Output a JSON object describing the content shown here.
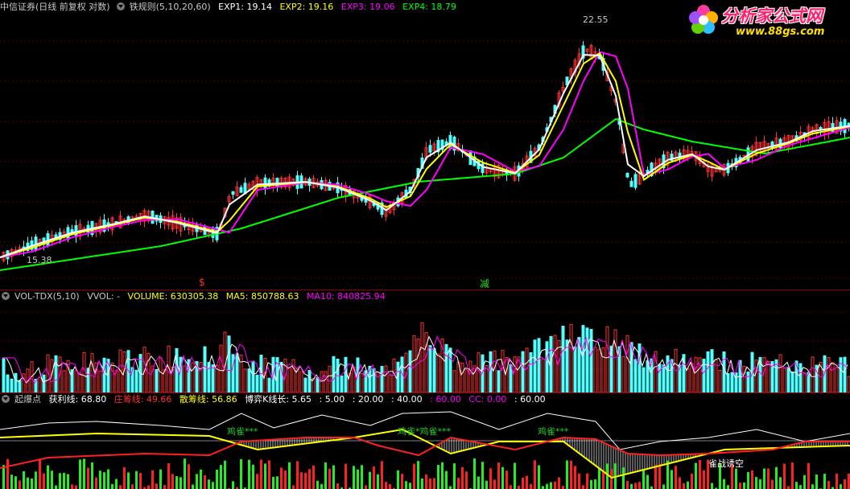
{
  "main": {
    "title": "中信证券(日线 前复权 对数)",
    "indicator": "铁规则(5,10,20,60)",
    "exp1": "EXP1: 19.14",
    "exp2": "EXP2: 19.16",
    "exp3": "EXP3: 19.06",
    "exp4": "EXP4: 18.79",
    "high_label": "22.55",
    "low_label": "15.38",
    "marker_s": "$",
    "marker_jian": "减"
  },
  "volume": {
    "indicator": "VOL-TDX(5,10)",
    "vvol": "VVOL: -",
    "volume": "VOLUME: 630305.38",
    "ma5": "MA5: 850788.63",
    "ma10": "MA10: 840825.94"
  },
  "bottom": {
    "indicator": "起爆点",
    "profit": "获利线: 68.80",
    "zhuang": "庄筹线: 49.66",
    "san": "散筹线: 56.86",
    "boyi": "博弈K线长: 5.65",
    "v1": ": 5.00",
    "v2": ": 20.00",
    "v3": ": 40.00",
    "v4": ": 60.00",
    "cc": "CC: 0.00",
    "v5": ": 60.00",
    "quezhan": "雀战诱空",
    "jique_labels": [
      "鸡雀***",
      "鸡雀*鸡雀***",
      "鸡雀***"
    ]
  },
  "logo": {
    "title": "分析家公式网",
    "url": "www.88gs.com"
  },
  "colors": {
    "ma5": "#ffffff",
    "ma10": "#ffff00",
    "ma20": "#ff00ff",
    "ma60": "#00ff00",
    "up": "#ff3232",
    "down": "#54ffff"
  }
}
